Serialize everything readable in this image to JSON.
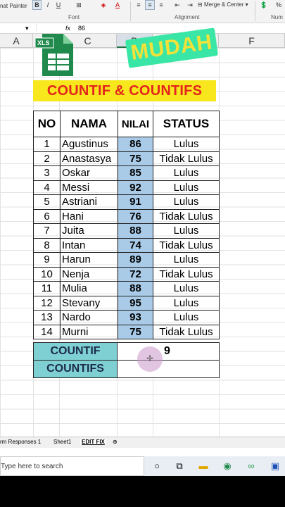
{
  "ribbon": {
    "format_painter": "nat Painter",
    "bold": "B",
    "italic": "I",
    "underline": "U",
    "font_group": "Font",
    "alignment_group": "Alignment",
    "merge_label": "Merge & Center",
    "number_group": "Num",
    "percent": "%"
  },
  "formula_bar": {
    "fx": "fx",
    "value": "86"
  },
  "columns": [
    "A",
    "C",
    "D",
    "E",
    "F"
  ],
  "logo_text": "XLS",
  "mudah": "MUDAH",
  "title": "COUNTIF & COUNTIFS",
  "table": {
    "headers": {
      "no": "NO",
      "nama": "NAMA",
      "nilai": "NILAI",
      "status": "STATUS"
    },
    "rows": [
      {
        "no": "1",
        "nama": "Agustinus",
        "nilai": "86",
        "status": "Lulus"
      },
      {
        "no": "2",
        "nama": "Anastasya",
        "nilai": "75",
        "status": "Tidak Lulus"
      },
      {
        "no": "3",
        "nama": "Oskar",
        "nilai": "85",
        "status": "Lulus"
      },
      {
        "no": "4",
        "nama": "Messi",
        "nilai": "92",
        "status": "Lulus"
      },
      {
        "no": "5",
        "nama": "Astriani",
        "nilai": "91",
        "status": "Lulus"
      },
      {
        "no": "6",
        "nama": "Hani",
        "nilai": "76",
        "status": "Tidak Lulus"
      },
      {
        "no": "7",
        "nama": "Juita",
        "nilai": "88",
        "status": "Lulus"
      },
      {
        "no": "8",
        "nama": "Intan",
        "nilai": "74",
        "status": "Tidak Lulus"
      },
      {
        "no": "9",
        "nama": "Harun",
        "nilai": "89",
        "status": "Lulus"
      },
      {
        "no": "10",
        "nama": " Nenja",
        "nilai": "72",
        "status": "Tidak Lulus"
      },
      {
        "no": "11",
        "nama": "Mulia",
        "nilai": "88",
        "status": "Lulus"
      },
      {
        "no": "12",
        "nama": "Stevany",
        "nilai": "95",
        "status": "Lulus"
      },
      {
        "no": "13",
        "nama": "Nardo",
        "nilai": "93",
        "status": "Lulus"
      },
      {
        "no": "14",
        "nama": "Murni",
        "nilai": "75",
        "status": "Tidak Lulus"
      }
    ]
  },
  "summary": {
    "countif_label": "COUNTIF",
    "countif_value": "9",
    "countifs_label": "COUNTIFS",
    "countifs_value": ""
  },
  "sheet_tabs": [
    "rm Responses 1",
    "Sheet1",
    "EDIT FIX"
  ],
  "taskbar": {
    "search_placeholder": "Type here to search"
  },
  "colors": {
    "title_bg": "#f8e71c",
    "title_fg": "#e3261c",
    "nilai_bg": "#a9cbe8",
    "summary_bg": "#7fd0d3",
    "mudah_bg": "#3ae6a5"
  }
}
